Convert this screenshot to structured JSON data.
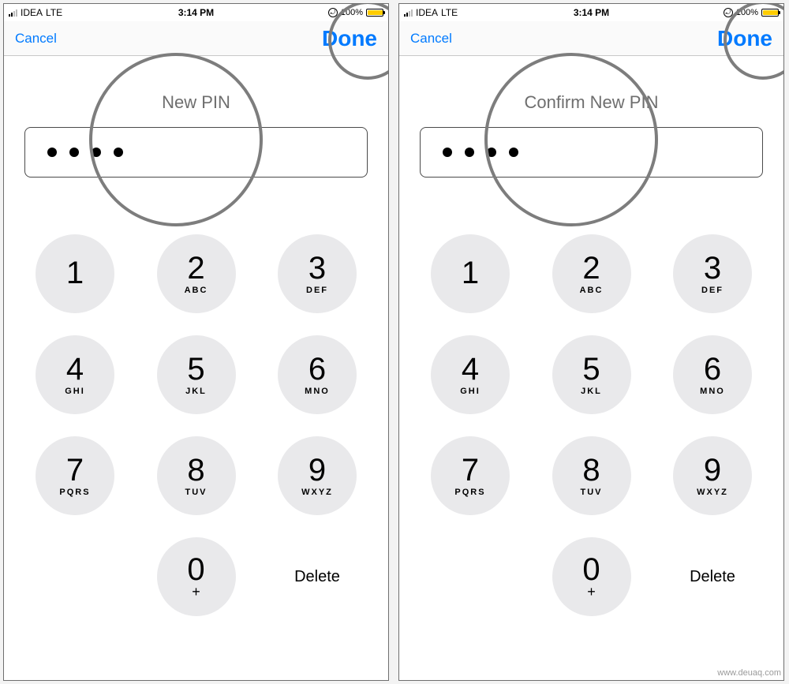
{
  "statusbar": {
    "carrier": "IDEA",
    "network": "LTE",
    "time": "3:14 PM",
    "battery_pct": "100%"
  },
  "nav": {
    "cancel": "Cancel",
    "done": "Done"
  },
  "screens": [
    {
      "title": "New PIN",
      "dots": 4
    },
    {
      "title": "Confirm New PIN",
      "dots": 4
    }
  ],
  "keypad": {
    "keys": [
      {
        "digit": "1",
        "letters": ""
      },
      {
        "digit": "2",
        "letters": "ABC"
      },
      {
        "digit": "3",
        "letters": "DEF"
      },
      {
        "digit": "4",
        "letters": "GHI"
      },
      {
        "digit": "5",
        "letters": "JKL"
      },
      {
        "digit": "6",
        "letters": "MNO"
      },
      {
        "digit": "7",
        "letters": "PQRS"
      },
      {
        "digit": "8",
        "letters": "TUV"
      },
      {
        "digit": "9",
        "letters": "WXYZ"
      }
    ],
    "zero": {
      "digit": "0",
      "sub": "+"
    },
    "delete": "Delete"
  },
  "watermark": "www.deuaq.com"
}
